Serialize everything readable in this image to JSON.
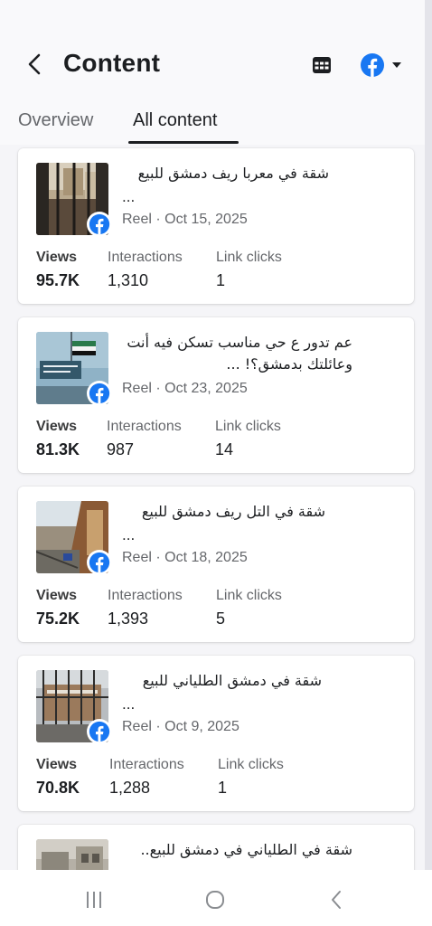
{
  "header": {
    "title": "Content",
    "back_icon": "chevron-left-icon",
    "table_icon": "table-icon",
    "platform_icon": "facebook-icon",
    "dropdown_icon": "caret-down-icon"
  },
  "tabs": [
    {
      "label": "Overview",
      "active": false
    },
    {
      "label": "All content",
      "active": true
    }
  ],
  "colors": {
    "facebook_blue": "#1877f2",
    "text_primary": "#1c1e21",
    "text_secondary": "#65676b"
  },
  "posts": [
    {
      "caption_lines": [
        "شقة في معربا ريف دمشق للبيع"
      ],
      "ellipsis": "...",
      "meta": "Reel · Oct 15, 2025",
      "stats": {
        "views_label": "Views",
        "views": "95.7K",
        "interactions_label": "Interactions",
        "interactions": "1,310",
        "link_clicks_label": "Link clicks",
        "link_clicks": "1"
      }
    },
    {
      "caption_lines": [
        "عم تدور ع حي مناسب تسكن فيه أنت",
        "وعائلتك بدمشق؟! ..."
      ],
      "ellipsis": "",
      "meta": "Reel · Oct 23, 2025",
      "stats": {
        "views_label": "Views",
        "views": "81.3K",
        "interactions_label": "Interactions",
        "interactions": "987",
        "link_clicks_label": "Link clicks",
        "link_clicks": "14"
      }
    },
    {
      "caption_lines": [
        "شقة في التل ريف دمشق للبيع"
      ],
      "ellipsis": "...",
      "meta": "Reel · Oct 18, 2025",
      "stats": {
        "views_label": "Views",
        "views": "75.2K",
        "interactions_label": "Interactions",
        "interactions": "1,393",
        "link_clicks_label": "Link clicks",
        "link_clicks": "5"
      }
    },
    {
      "caption_lines": [
        "شقة في دمشق الطلياني للبيع"
      ],
      "ellipsis": "...",
      "meta": "Reel · Oct 9, 2025",
      "stats": {
        "views_label": "Views",
        "views": "70.8K",
        "interactions_label": "Interactions",
        "interactions": "1,288",
        "link_clicks_label": "Link clicks",
        "link_clicks": "1"
      }
    },
    {
      "caption_lines": [
        "شقة في الطلياني في دمشق للبيع.."
      ],
      "ellipsis": "",
      "meta": "",
      "stats": {}
    }
  ],
  "navbar": {
    "recents_icon": "recent-apps-icon",
    "home_icon": "home-circle-icon",
    "back_icon": "system-back-icon"
  }
}
